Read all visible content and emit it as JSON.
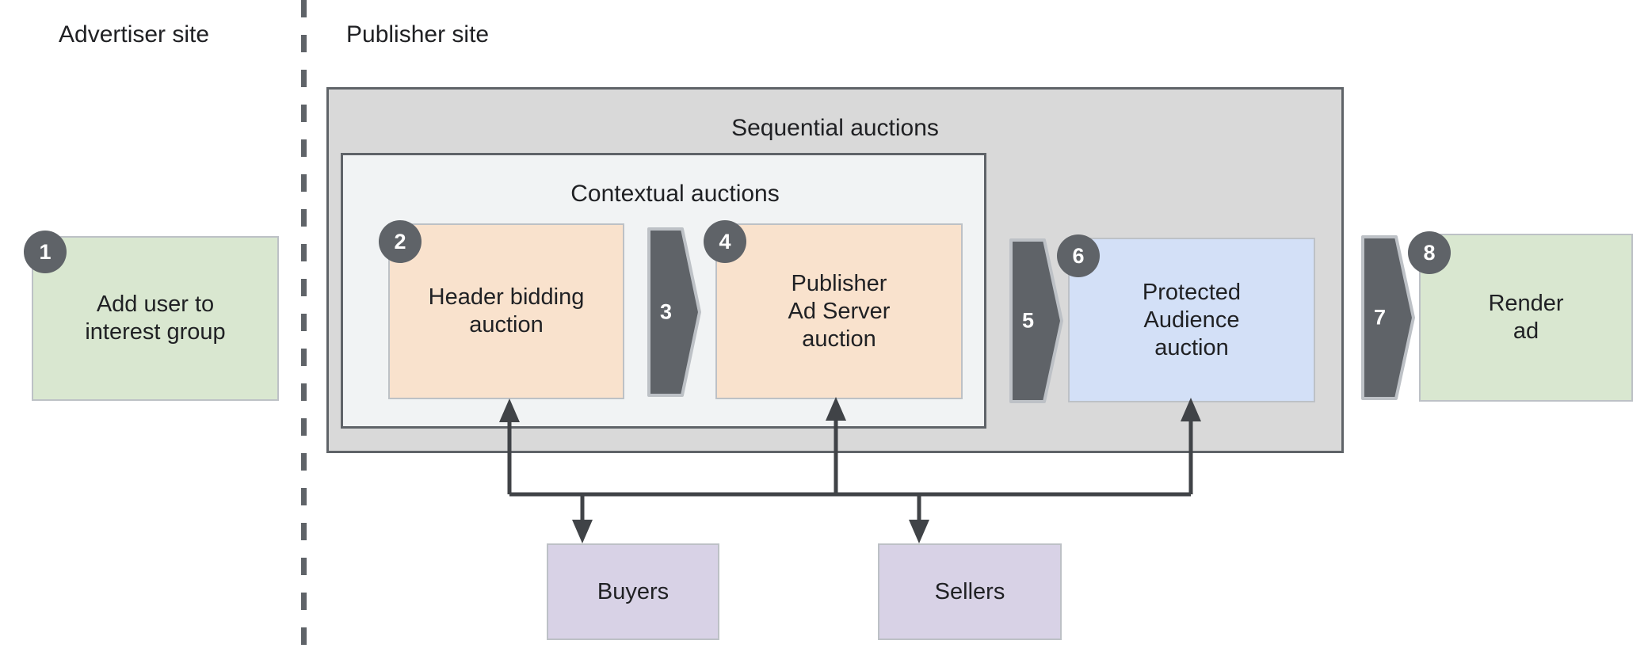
{
  "sections": {
    "advertiser": "Advertiser site",
    "publisher": "Publisher site"
  },
  "containers": {
    "sequential": "Sequential auctions",
    "contextual": "Contextual auctions"
  },
  "nodes": {
    "add_user": "Add user to\ninterest group",
    "header_bidding": "Header bidding\nauction",
    "pub_ad_server": "Publisher\nAd Server\nauction",
    "protected_audience": "Protected\nAudience\nauction",
    "render_ad": "Render\nad",
    "buyers": "Buyers",
    "sellers": "Sellers"
  },
  "badges": {
    "one": "1",
    "two": "2",
    "four": "4",
    "six": "6",
    "eight": "8"
  },
  "arrows": {
    "three": "3",
    "five": "5",
    "seven": "7"
  },
  "colors": {
    "green_fill": "#d9e7d0",
    "orange_fill": "#f9e2cd",
    "blue_fill": "#d3e0f7",
    "purple_fill": "#d8d2e6",
    "sequential_fill": "#d9d9d9",
    "contextual_fill": "#f1f3f4",
    "badge_fill": "#5f6368",
    "stroke": "#404347",
    "node_border": "#bdc1c6"
  }
}
